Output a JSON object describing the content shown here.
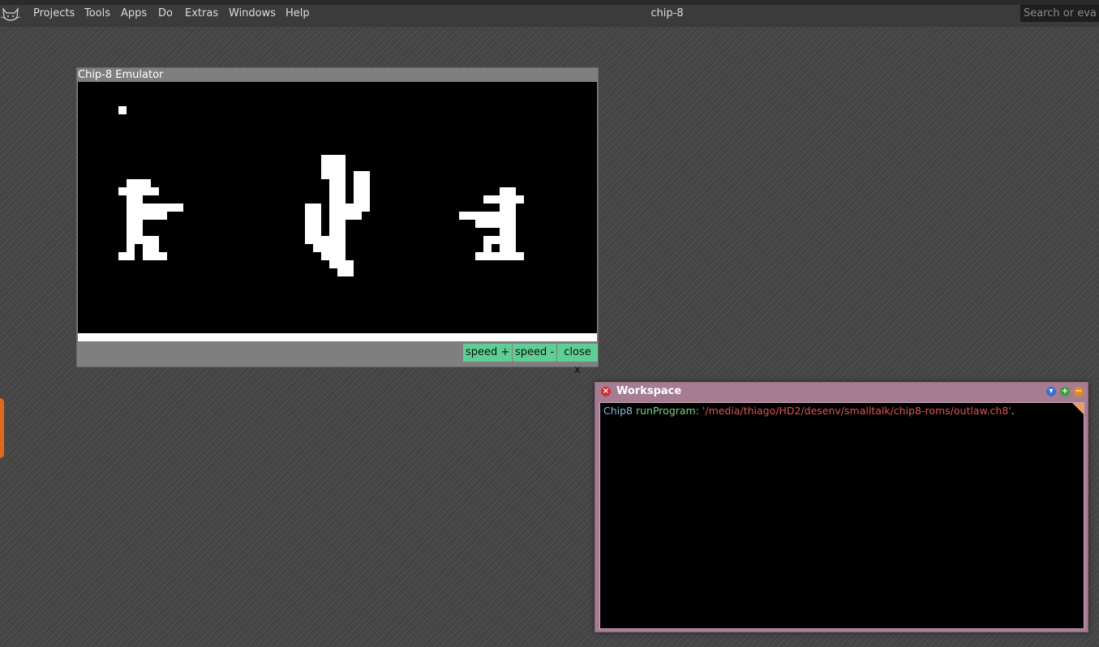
{
  "menubar": {
    "items": [
      "Projects",
      "Tools",
      "Apps",
      "Do",
      "Extras",
      "Windows",
      "Help"
    ],
    "title": "chip-8",
    "search_placeholder": "Search or evaluate"
  },
  "emulator": {
    "title": "Chip-8 Emulator",
    "buttons": {
      "speed_up": "speed +",
      "speed_down": "speed -",
      "close": "close x"
    }
  },
  "workspace": {
    "title": "Workspace",
    "code": {
      "receiver": "Chip8",
      "selector": "runProgram:",
      "argument": "'/media/thiago/HD2/desenv/smalltalk/chip8-roms/outlaw.ch8'",
      "terminator": "."
    }
  },
  "colors": {
    "desktop": "#454545",
    "button_green": "#5fce95",
    "workspace_frame": "#a67c93",
    "string_red": "#e05555",
    "selector_green": "#7fd07f",
    "class_blue": "#8ab8e0"
  },
  "icons": [
    "cat-logo-icon",
    "close-icon",
    "menu-down-icon",
    "expand-icon",
    "collapse-icon"
  ]
}
